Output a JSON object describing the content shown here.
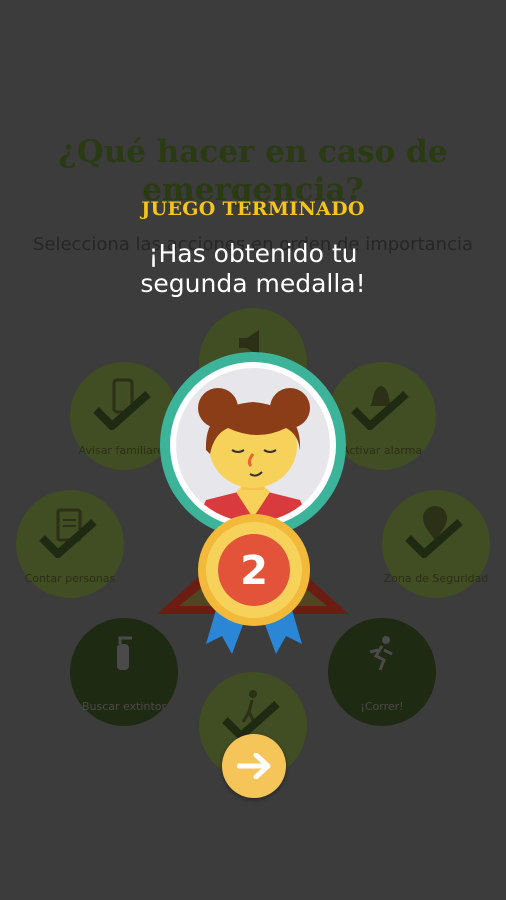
{
  "background": {
    "title": "¿Qué hacer en caso de emergencia?",
    "subtitle": "Selecciona las acciones en orden de importancia",
    "actions": [
      {
        "label": "",
        "icon": "megaphone-icon"
      },
      {
        "label": "Avisar familiares",
        "icon": "phone-icon"
      },
      {
        "label": "Activar alarma",
        "icon": "bell-icon"
      },
      {
        "label": "Contar personas",
        "icon": "clipboard-icon"
      },
      {
        "label": "Zona de Seguridad",
        "icon": "map-pin-icon"
      },
      {
        "label": "Buscar extintor",
        "icon": "fire-extinguisher-icon"
      },
      {
        "label": "¡Correr!",
        "icon": "running-person-icon"
      },
      {
        "label": "",
        "icon": "walking-person-icon"
      }
    ]
  },
  "overlay": {
    "title": "JUEGO TERMINADO",
    "message_line1": "¡Has obtenido tu",
    "message_line2": "segunda medalla!",
    "medal_number": "2"
  },
  "colors": {
    "accent_yellow": "#f6c51a",
    "medal_ring": "#3cb49a",
    "badge_red": "#e2533a",
    "ribbon_blue": "#2b86d6",
    "next_button": "#f6c55a"
  }
}
